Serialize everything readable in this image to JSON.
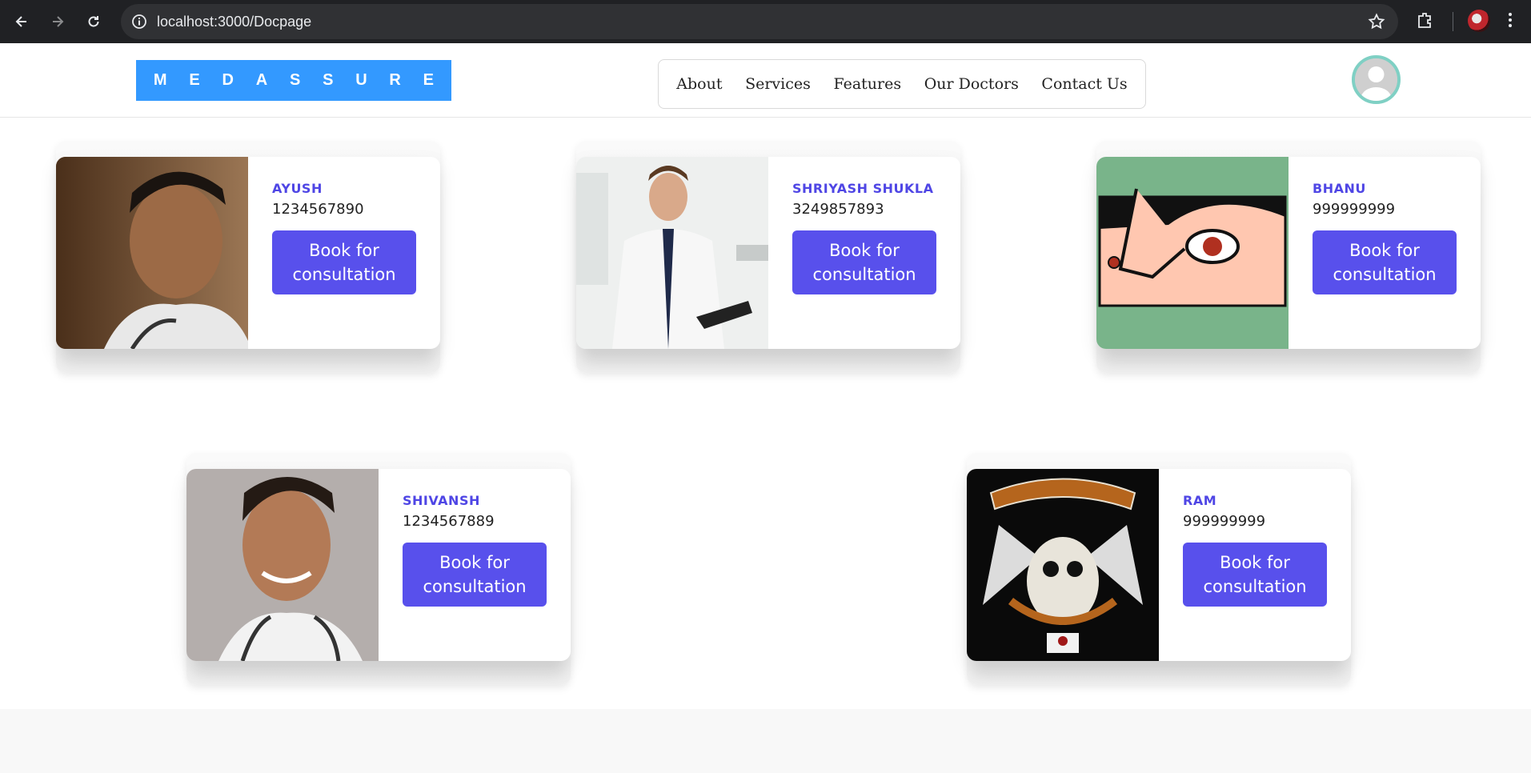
{
  "browser": {
    "url": "localhost:3000/Docpage"
  },
  "header": {
    "logo_letters": [
      "M",
      "E",
      "D",
      "A",
      "S",
      "S",
      "U",
      "R",
      "E"
    ],
    "nav": [
      "About",
      "Services",
      "Features",
      "Our Doctors",
      "Contact Us"
    ]
  },
  "doctors": [
    {
      "name": "AYUSH",
      "phone": "1234567890",
      "button": "Book for consultation"
    },
    {
      "name": "SHRIYASH SHUKLA",
      "phone": "3249857893",
      "button": "Book for consultation"
    },
    {
      "name": "BHANU",
      "phone": "999999999",
      "button": "Book for consultation"
    },
    {
      "name": "SHIVANSH",
      "phone": "1234567889",
      "button": "Book for consultation"
    },
    {
      "name": "RAM",
      "phone": "999999999",
      "button": "Book for consultation"
    }
  ],
  "colors": {
    "logo_bg": "#3399ff",
    "accent": "#5850ec",
    "name_color": "#4f46e5"
  }
}
